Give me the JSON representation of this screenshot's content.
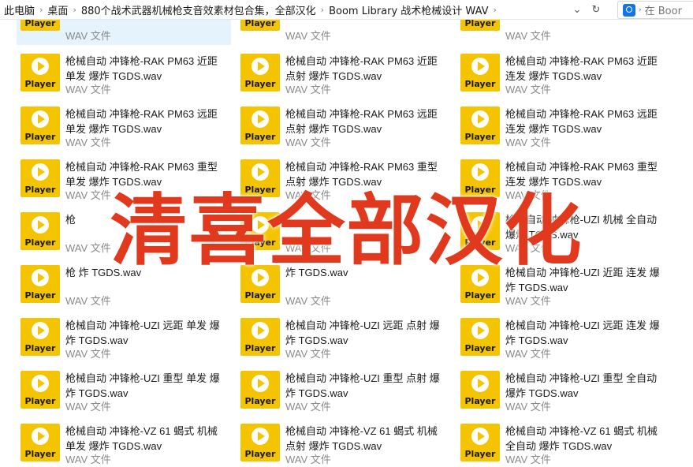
{
  "breadcrumb": [
    "此电脑",
    "桌面",
    "880个战术武器机械枪支音效素材包合集，全部汉化",
    "Boom Library 战术枪械设计 WAV"
  ],
  "search": {
    "placeholder": "在 Boor"
  },
  "file_type": "WAV 文件",
  "thumb_label": "Player",
  "overlay_text": "清喜全部汉化",
  "files": [
    [
      "枪械自动 冲锋枪-RAK PM63 近距 单发 爆炸 TGDS.wav",
      "枪械自动 冲锋枪-RAK PM63 近距 点射 爆炸 TGDS.wav",
      "枪械自动 冲锋枪-RAK PM63 近距 连发 爆炸 TGDS.wav"
    ],
    [
      "枪械自动 冲锋枪-RAK PM63 远距 单发 爆炸 TGDS.wav",
      "枪械自动 冲锋枪-RAK PM63 远距 点射 爆炸 TGDS.wav",
      "枪械自动 冲锋枪-RAK PM63 远距 连发 爆炸 TGDS.wav"
    ],
    [
      "枪械自动 冲锋枪-RAK PM63 重型 单发 爆炸 TGDS.wav",
      "枪械自动 冲锋枪-RAK PM63 重型 点射 爆炸 TGDS.wav",
      "枪械自动 冲锋枪-RAK PM63 重型 连发 爆炸 TGDS.wav"
    ],
    [
      "枪",
      "",
      "枪械自动 冲锋枪-UZI 机械 全自动 爆炸 TGDS.wav"
    ],
    [
      "枪 炸 TGDS.wav",
      "炸 TGDS.wav",
      "枪械自动 冲锋枪-UZI 近距 连发 爆炸 TGDS.wav"
    ],
    [
      "枪械自动 冲锋枪-UZI 远距 单发 爆炸 TGDS.wav",
      "枪械自动 冲锋枪-UZI 远距 点射 爆炸 TGDS.wav",
      "枪械自动 冲锋枪-UZI 远距 连发 爆炸 TGDS.wav"
    ],
    [
      "枪械自动 冲锋枪-UZI 重型 单发 爆炸 TGDS.wav",
      "枪械自动 冲锋枪-UZI 重型 点射 爆炸 TGDS.wav",
      "枪械自动 冲锋枪-UZI 重型 全自动 爆炸 TGDS.wav"
    ],
    [
      "枪械自动 冲锋枪-VZ 61 蝎式 机械 单发 爆炸 TGDS.wav",
      "枪械自动 冲锋枪-VZ 61 蝎式 机械 点射 爆炸 TGDS.wav",
      "枪械自动 冲锋枪-VZ 61 蝎式 机械 全自动 爆炸 TGDS.wav"
    ]
  ]
}
